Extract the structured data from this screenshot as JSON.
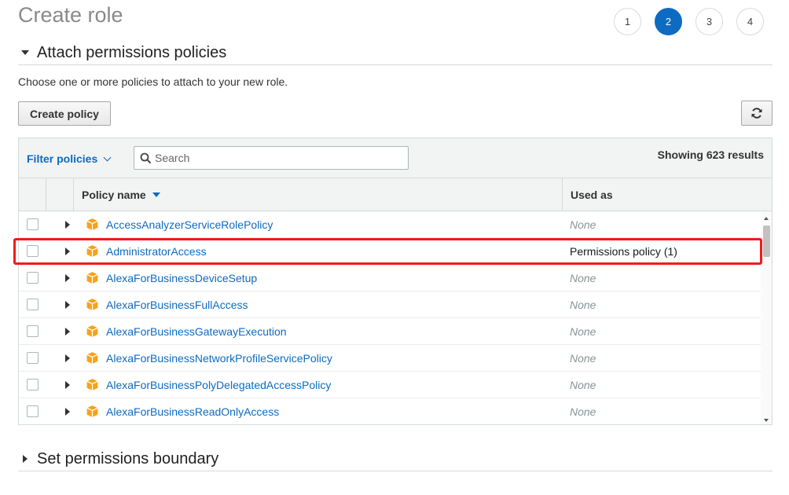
{
  "page": {
    "title": "Create role"
  },
  "steps": [
    {
      "label": "1",
      "active": false
    },
    {
      "label": "2",
      "active": true
    },
    {
      "label": "3",
      "active": false
    },
    {
      "label": "4",
      "active": false
    }
  ],
  "attach_section": {
    "title": "Attach permissions policies",
    "description": "Choose one or more policies to attach to your new role.",
    "create_policy_label": "Create policy"
  },
  "filter": {
    "label": "Filter policies",
    "search_placeholder": "Search",
    "results_text": "Showing 623 results"
  },
  "table": {
    "columns": {
      "policy_name": "Policy name",
      "used_as": "Used as"
    },
    "rows": [
      {
        "name": "AccessAnalyzerServiceRolePolicy",
        "used_as": "None"
      },
      {
        "name": "AdministratorAccess",
        "used_as": "Permissions policy (1)"
      },
      {
        "name": "AlexaForBusinessDeviceSetup",
        "used_as": "None"
      },
      {
        "name": "AlexaForBusinessFullAccess",
        "used_as": "None"
      },
      {
        "name": "AlexaForBusinessGatewayExecution",
        "used_as": "None"
      },
      {
        "name": "AlexaForBusinessNetworkProfileServicePolicy",
        "used_as": "None"
      },
      {
        "name": "AlexaForBusinessPolyDelegatedAccessPolicy",
        "used_as": "None"
      },
      {
        "name": "AlexaForBusinessReadOnlyAccess",
        "used_as": "None"
      }
    ]
  },
  "boundary_section": {
    "title": "Set permissions boundary"
  },
  "colors": {
    "accent": "#0d6bc1",
    "policy_icon": "#f7a21b",
    "highlight": "#f01b1b"
  }
}
